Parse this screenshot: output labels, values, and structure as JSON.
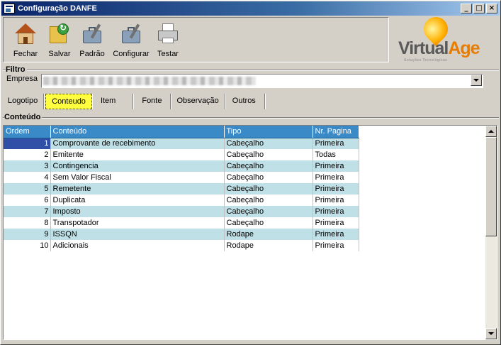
{
  "window": {
    "title": "Configuração DANFE",
    "minimize_glyph": "_",
    "maximize_glyph": "□",
    "close_glyph": "×"
  },
  "toolbar": {
    "buttons": [
      {
        "label": "Fechar",
        "icon": "house-icon"
      },
      {
        "label": "Salvar",
        "icon": "save-folder-icon"
      },
      {
        "label": "Padrão",
        "icon": "briefcase-tools-icon"
      },
      {
        "label": "Configurar",
        "icon": "briefcase-tools-icon"
      },
      {
        "label": "Testar",
        "icon": "printer-icon"
      }
    ]
  },
  "logo": {
    "brand_virtual": "Virtual",
    "brand_age": "Age",
    "tagline": "Soluções Tecnológicas"
  },
  "filtro": {
    "title": "Filtro",
    "empresa_label": "Empresa"
  },
  "tabs": [
    "Logotipo",
    "Conteudo",
    "Item",
    "Fonte",
    "Observação",
    "Outros"
  ],
  "conteudo": {
    "title": "Conteúdo",
    "columns": [
      "Ordem",
      "Conteúdo",
      "Tipo",
      "Nr. Pagina"
    ],
    "rows": [
      [
        "1",
        "Comprovante de recebimento",
        "Cabeçalho",
        "Primeira"
      ],
      [
        "2",
        "Emitente",
        "Cabeçalho",
        "Todas"
      ],
      [
        "3",
        "Contingencia",
        "Cabeçalho",
        "Primeira"
      ],
      [
        "4",
        "Sem Valor Fiscal",
        "Cabeçalho",
        "Primeira"
      ],
      [
        "5",
        "Remetente",
        "Cabeçalho",
        "Primeira"
      ],
      [
        "6",
        "Duplicata",
        "Cabeçalho",
        "Primeira"
      ],
      [
        "7",
        "Imposto",
        "Cabeçalho",
        "Primeira"
      ],
      [
        "8",
        "Transpotador",
        "Cabeçalho",
        "Primeira"
      ],
      [
        "9",
        "ISSQN",
        "Rodape",
        "Primeira"
      ],
      [
        "10",
        "Adicionais",
        "Rodape",
        "Primeira"
      ]
    ]
  },
  "colors": {
    "header_bg": "#3a8ac8",
    "alt_row_bg": "#bfe0e6",
    "active_tab_bg": "#ffff40",
    "selected_cell_bg": "#3050a8"
  }
}
